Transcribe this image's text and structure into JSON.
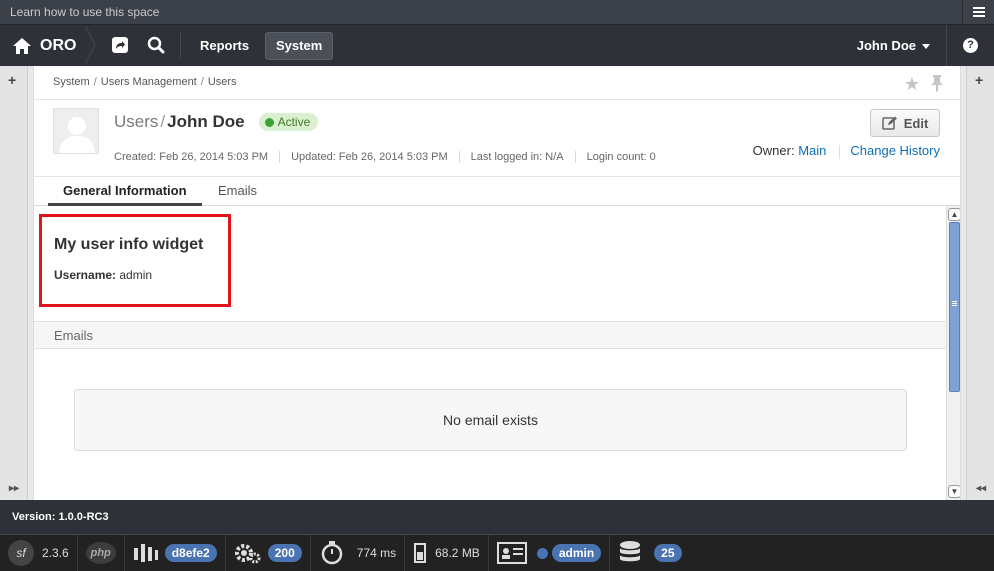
{
  "help_strip": {
    "text": "Learn how to use this space"
  },
  "nav": {
    "logo": "ORO",
    "links": [
      {
        "label": "Reports",
        "active": false
      },
      {
        "label": "System",
        "active": true
      }
    ],
    "user": "John Doe"
  },
  "breadcrumb": [
    "System",
    "Users Management",
    "Users"
  ],
  "header": {
    "entity": "Users",
    "name": "John Doe",
    "status": "Active",
    "meta": [
      "Created: Feb 26, 2014 5:03 PM",
      "Updated: Feb 26, 2014 5:03 PM",
      "Last logged in: N/A",
      "Login count: 0"
    ],
    "edit_label": "Edit",
    "owner_label": "Owner:",
    "owner_value": "Main",
    "history_label": "Change History"
  },
  "tabs": [
    {
      "label": "General Information",
      "active": true
    },
    {
      "label": "Emails",
      "active": false
    }
  ],
  "widget": {
    "title": "My user info widget",
    "username_label": "Username:",
    "username_value": "admin"
  },
  "emails_section": {
    "title": "Emails",
    "empty_text": "No email exists"
  },
  "version": "Version: 1.0.0-RC3",
  "debug_toolbar": {
    "symfony_version": "2.3.6",
    "php_label": "php",
    "token": "d8efe2",
    "status_code": "200",
    "time": "774 ms",
    "memory": "68.2 MB",
    "user": "admin",
    "queries": "25"
  },
  "colors": {
    "nav_bg": "#2e3138",
    "highlight_border": "#e3131b",
    "link": "#0e6fb8",
    "active_badge_bg": "#dbf0d0",
    "pill": "#4a74b1"
  }
}
